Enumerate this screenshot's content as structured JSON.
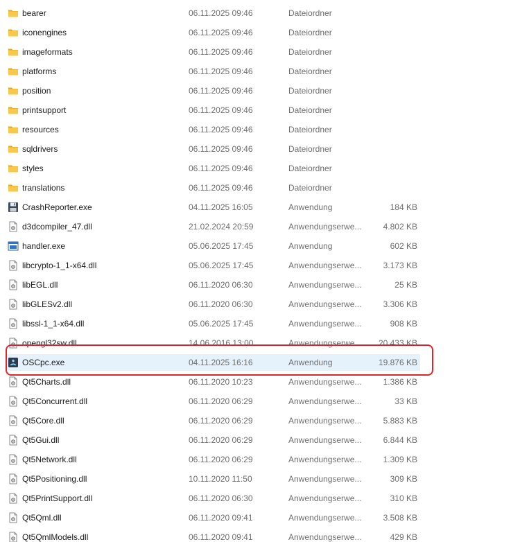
{
  "files": [
    {
      "name": "bearer",
      "date": "06.11.2025 09:46",
      "type": "Dateiordner",
      "size": "",
      "icon": "folder-icon"
    },
    {
      "name": "iconengines",
      "date": "06.11.2025 09:46",
      "type": "Dateiordner",
      "size": "",
      "icon": "folder-icon"
    },
    {
      "name": "imageformats",
      "date": "06.11.2025 09:46",
      "type": "Dateiordner",
      "size": "",
      "icon": "folder-icon"
    },
    {
      "name": "platforms",
      "date": "06.11.2025 09:46",
      "type": "Dateiordner",
      "size": "",
      "icon": "folder-icon"
    },
    {
      "name": "position",
      "date": "06.11.2025 09:46",
      "type": "Dateiordner",
      "size": "",
      "icon": "folder-icon"
    },
    {
      "name": "printsupport",
      "date": "06.11.2025 09:46",
      "type": "Dateiordner",
      "size": "",
      "icon": "folder-icon"
    },
    {
      "name": "resources",
      "date": "06.11.2025 09:46",
      "type": "Dateiordner",
      "size": "",
      "icon": "folder-icon"
    },
    {
      "name": "sqldrivers",
      "date": "06.11.2025 09:46",
      "type": "Dateiordner",
      "size": "",
      "icon": "folder-icon"
    },
    {
      "name": "styles",
      "date": "06.11.2025 09:46",
      "type": "Dateiordner",
      "size": "",
      "icon": "folder-icon"
    },
    {
      "name": "translations",
      "date": "06.11.2025 09:46",
      "type": "Dateiordner",
      "size": "",
      "icon": "folder-icon"
    },
    {
      "name": "CrashReporter.exe",
      "date": "04.11.2025 16:05",
      "type": "Anwendung",
      "size": "184 KB",
      "icon": "floppy-disk-icon"
    },
    {
      "name": "d3dcompiler_47.dll",
      "date": "21.02.2024 20:59",
      "type": "Anwendungserwe...",
      "size": "4.802 KB",
      "icon": "dll-file-icon"
    },
    {
      "name": "handler.exe",
      "date": "05.06.2025 17:45",
      "type": "Anwendung",
      "size": "602 KB",
      "icon": "application-window-icon"
    },
    {
      "name": "libcrypto-1_1-x64.dll",
      "date": "05.06.2025 17:45",
      "type": "Anwendungserwe...",
      "size": "3.173 KB",
      "icon": "dll-file-icon"
    },
    {
      "name": "libEGL.dll",
      "date": "06.11.2020 06:30",
      "type": "Anwendungserwe...",
      "size": "25 KB",
      "icon": "dll-file-icon"
    },
    {
      "name": "libGLESv2.dll",
      "date": "06.11.2020 06:30",
      "type": "Anwendungserwe...",
      "size": "3.306 KB",
      "icon": "dll-file-icon"
    },
    {
      "name": "libssl-1_1-x64.dll",
      "date": "05.06.2025 17:45",
      "type": "Anwendungserwe...",
      "size": "908 KB",
      "icon": "dll-file-icon"
    },
    {
      "name": "opengl32sw.dll",
      "date": "14.06.2016 13:00",
      "type": "Anwendungserwe...",
      "size": "20.433 KB",
      "icon": "dll-file-icon"
    },
    {
      "name": "OSCpc.exe",
      "date": "04.11.2025 16:16",
      "type": "Anwendung",
      "size": "19.876 KB",
      "icon": "oscpc-app-icon",
      "selected": true
    },
    {
      "name": "Qt5Charts.dll",
      "date": "06.11.2020 10:23",
      "type": "Anwendungserwe...",
      "size": "1.386 KB",
      "icon": "dll-file-icon"
    },
    {
      "name": "Qt5Concurrent.dll",
      "date": "06.11.2020 06:29",
      "type": "Anwendungserwe...",
      "size": "33 KB",
      "icon": "dll-file-icon"
    },
    {
      "name": "Qt5Core.dll",
      "date": "06.11.2020 06:29",
      "type": "Anwendungserwe...",
      "size": "5.883 KB",
      "icon": "dll-file-icon"
    },
    {
      "name": "Qt5Gui.dll",
      "date": "06.11.2020 06:29",
      "type": "Anwendungserwe...",
      "size": "6.844 KB",
      "icon": "dll-file-icon"
    },
    {
      "name": "Qt5Network.dll",
      "date": "06.11.2020 06:29",
      "type": "Anwendungserwe...",
      "size": "1.309 KB",
      "icon": "dll-file-icon"
    },
    {
      "name": "Qt5Positioning.dll",
      "date": "10.11.2020 11:50",
      "type": "Anwendungserwe...",
      "size": "309 KB",
      "icon": "dll-file-icon"
    },
    {
      "name": "Qt5PrintSupport.dll",
      "date": "06.11.2020 06:30",
      "type": "Anwendungserwe...",
      "size": "310 KB",
      "icon": "dll-file-icon"
    },
    {
      "name": "Qt5Qml.dll",
      "date": "06.11.2020 09:41",
      "type": "Anwendungserwe...",
      "size": "3.508 KB",
      "icon": "dll-file-icon"
    },
    {
      "name": "Qt5QmlModels.dll",
      "date": "06.11.2020 09:41",
      "type": "Anwendungserwe...",
      "size": "429 KB",
      "icon": "dll-file-icon"
    }
  ],
  "colors": {
    "folder": "#f6c344",
    "selection": "#e5f1fb",
    "highlight": "#e0242c"
  }
}
